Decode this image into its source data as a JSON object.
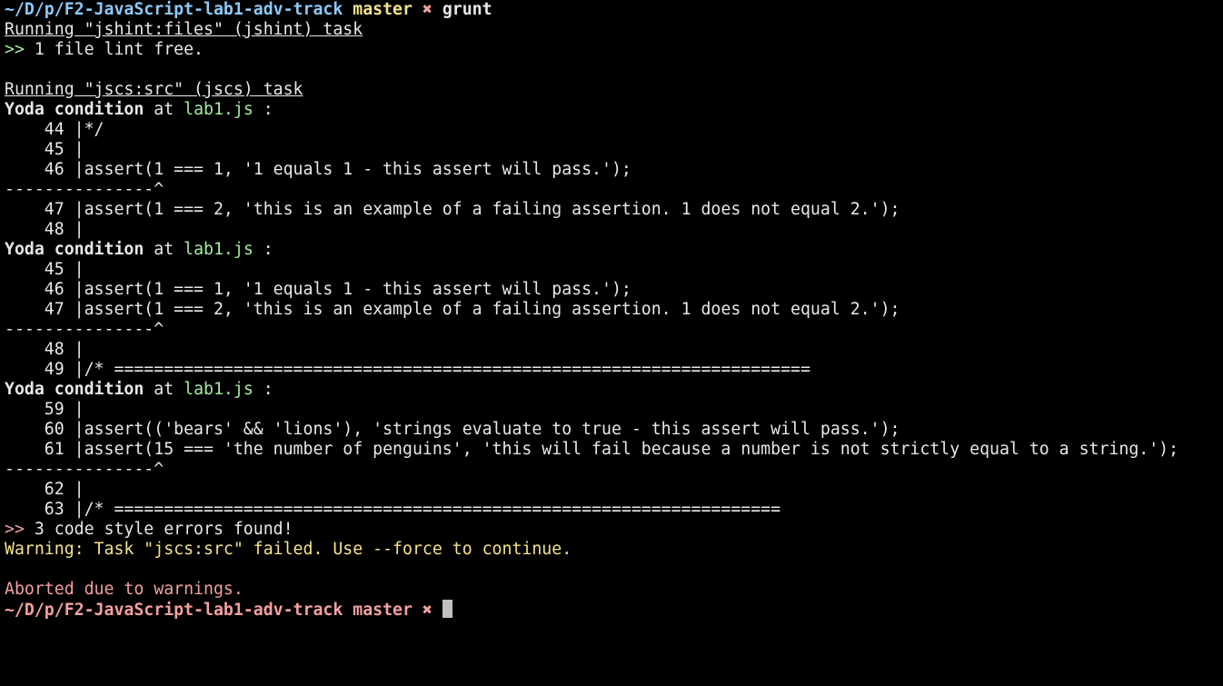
{
  "colors": {
    "background": "#000000",
    "default": "#e8e8e8",
    "path": "#8ec8f6",
    "branch": "#f5e28b",
    "dirty": "#f3a0a0",
    "green": "#a6e9a0",
    "file": "#a6e9a0",
    "warning": "#f5e28b",
    "error": "#f3a0a0",
    "cursor": "#c0c0c0"
  },
  "lines": [
    {
      "segs": [
        {
          "text": "~/D/p/F2-JavaScript-lab1-adv-track",
          "color": "path",
          "bold": true
        },
        {
          "text": " "
        },
        {
          "text": "master",
          "color": "branch",
          "bold": true
        },
        {
          "text": " "
        },
        {
          "text": "✖",
          "color": "dirty",
          "bold": true
        },
        {
          "text": " "
        },
        {
          "text": "grunt",
          "bold": true
        }
      ]
    },
    {
      "segs": [
        {
          "text": "Running \"jshint:files\" (jshint) task",
          "underline": true
        }
      ]
    },
    {
      "segs": [
        {
          "text": ">>",
          "color": "green"
        },
        {
          "text": " 1 file lint free."
        }
      ]
    },
    {
      "segs": []
    },
    {
      "segs": [
        {
          "text": "Running \"jscs:src\" (jscs) task",
          "underline": true
        }
      ]
    },
    {
      "segs": [
        {
          "text": "Yoda condition",
          "bold": true
        },
        {
          "text": " at "
        },
        {
          "text": "lab1.js",
          "color": "file"
        },
        {
          "text": " :"
        }
      ]
    },
    {
      "segs": [
        {
          "text": "    44 |*/"
        }
      ]
    },
    {
      "segs": [
        {
          "text": "    45 |"
        }
      ]
    },
    {
      "segs": [
        {
          "text": "    46 |assert(1 === 1, '1 equals 1 - this assert will pass.');"
        }
      ]
    },
    {
      "segs": [
        {
          "text": "---------------^"
        }
      ]
    },
    {
      "segs": [
        {
          "text": "    47 |assert(1 === 2, 'this is an example of a failing assertion. 1 does not equal 2.');"
        }
      ]
    },
    {
      "segs": [
        {
          "text": "    48 |"
        }
      ]
    },
    {
      "segs": [
        {
          "text": "Yoda condition",
          "bold": true
        },
        {
          "text": " at "
        },
        {
          "text": "lab1.js",
          "color": "file"
        },
        {
          "text": " :"
        }
      ]
    },
    {
      "segs": [
        {
          "text": "    45 |"
        }
      ]
    },
    {
      "segs": [
        {
          "text": "    46 |assert(1 === 1, '1 equals 1 - this assert will pass.');"
        }
      ]
    },
    {
      "segs": [
        {
          "text": "    47 |assert(1 === 2, 'this is an example of a failing assertion. 1 does not equal 2.');"
        }
      ]
    },
    {
      "segs": [
        {
          "text": "---------------^"
        }
      ]
    },
    {
      "segs": [
        {
          "text": "    48 |"
        }
      ]
    },
    {
      "segs": [
        {
          "text": "    49 |/* ======================================================================"
        }
      ]
    },
    {
      "segs": [
        {
          "text": "Yoda condition",
          "bold": true
        },
        {
          "text": " at "
        },
        {
          "text": "lab1.js",
          "color": "file"
        },
        {
          "text": " :"
        }
      ]
    },
    {
      "segs": [
        {
          "text": "    59 |"
        }
      ]
    },
    {
      "segs": [
        {
          "text": "    60 |assert(('bears' && 'lions'), 'strings evaluate to true - this assert will pass.');"
        }
      ]
    },
    {
      "segs": [
        {
          "text": "    61 |assert(15 === 'the number of penguins', 'this will fail because a number is not strictly equal to a string.');"
        }
      ]
    },
    {
      "segs": [
        {
          "text": "---------------^"
        }
      ]
    },
    {
      "segs": [
        {
          "text": "    62 |"
        }
      ]
    },
    {
      "segs": [
        {
          "text": "    63 |/* ==================================================================="
        }
      ]
    },
    {
      "segs": [
        {
          "text": ">>",
          "color": "error"
        },
        {
          "text": " 3 code style errors found!"
        }
      ]
    },
    {
      "segs": [
        {
          "text": "Warning: Task \"jscs:src\" failed. Use --force to continue.",
          "color": "warning"
        }
      ]
    },
    {
      "segs": []
    },
    {
      "segs": [
        {
          "text": "Aborted due to warnings.",
          "color": "error"
        }
      ]
    },
    {
      "segs": [
        {
          "text": "~/D/p/F2-JavaScript-lab1-adv-track",
          "color": "dirty",
          "bold": true
        },
        {
          "text": " "
        },
        {
          "text": "master",
          "color": "dirty",
          "bold": true
        },
        {
          "text": " "
        },
        {
          "text": "✖",
          "color": "dirty",
          "bold": true
        },
        {
          "text": " "
        },
        {
          "cursor": true
        }
      ]
    }
  ]
}
